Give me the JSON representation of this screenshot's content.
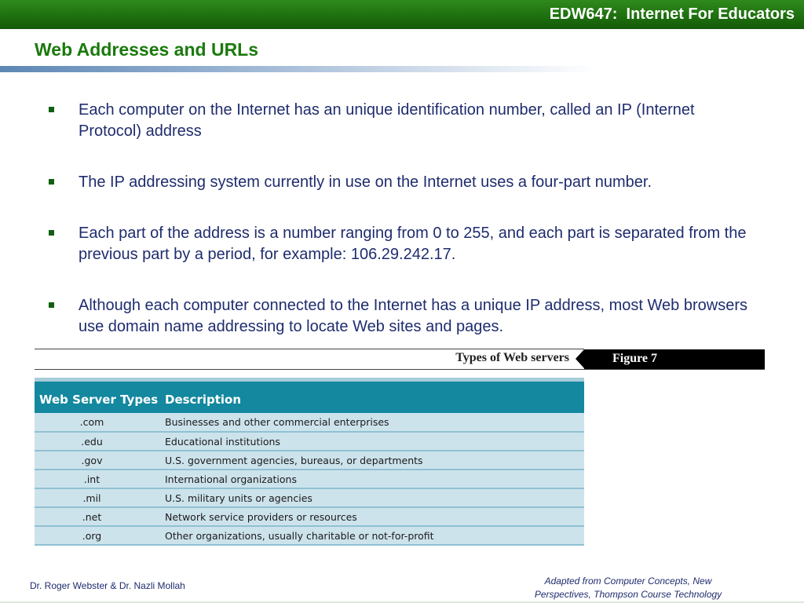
{
  "header": {
    "course_title": "EDW647:  Internet For Educators",
    "slide_title": "Web Addresses and URLs"
  },
  "bullets": [
    "Each computer on the Internet has an unique identification number, called an IP (Internet Protocol) address",
    "The IP addressing system currently in use on the Internet uses a four-part number.",
    "Each part of the address is a number ranging from 0 to 255, and each part is separated from the previous part by a period, for example: 106.29.242.17.",
    "Although each computer connected to the Internet has a unique IP address, most Web browsers use domain name addressing to locate Web sites and pages."
  ],
  "figure": {
    "caption": "Types of Web servers",
    "label": "Figure 7"
  },
  "table": {
    "headers": [
      "Web Server Types",
      "Description"
    ],
    "rows": [
      [
        ".com",
        "Businesses and other commercial enterprises"
      ],
      [
        ".edu",
        "Educational institutions"
      ],
      [
        ".gov",
        "U.S. government agencies, bureaus, or departments"
      ],
      [
        ".int",
        "International organizations"
      ],
      [
        ".mil",
        "U.S. military units or agencies"
      ],
      [
        ".net",
        "Network service providers or resources"
      ],
      [
        ".org",
        "Other organizations, usually charitable or not-for-profit"
      ]
    ]
  },
  "footer": {
    "authors": "Dr. Roger Webster & Dr. Nazli Mollah",
    "source_line1": "Adapted from Computer Concepts, New",
    "source_line2": "Perspectives, Thompson Course Technology"
  },
  "colors": {
    "header_bar": "#1f7010",
    "title_green": "#1a7a0d",
    "body_text": "#1f2c6e",
    "table_header": "#13889f",
    "table_row": "#cde3ec"
  }
}
